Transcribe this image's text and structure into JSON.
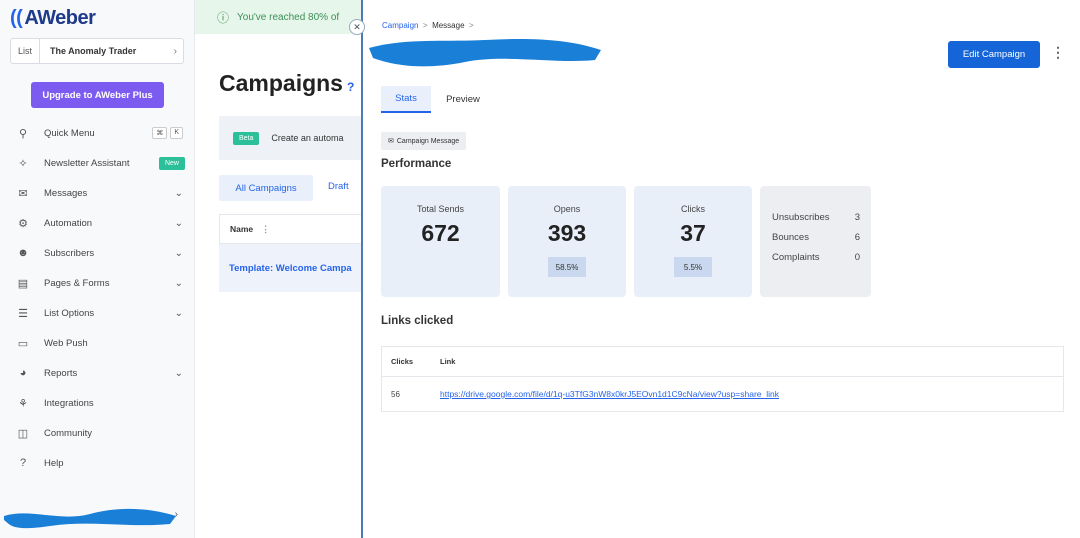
{
  "sidebar": {
    "logo": "AWeber",
    "list_label": "List",
    "list_value": "The Anomaly Trader",
    "upgrade_label": "Upgrade to AWeber Plus",
    "quick_menu_keys": [
      "⌘",
      "K"
    ],
    "new_badge": "New",
    "items": [
      {
        "label": "Quick Menu",
        "icon": "person-run-icon"
      },
      {
        "label": "Newsletter Assistant",
        "icon": "sparkle-icon"
      },
      {
        "label": "Messages",
        "icon": "mail-icon"
      },
      {
        "label": "Automation",
        "icon": "automation-icon"
      },
      {
        "label": "Subscribers",
        "icon": "users-icon"
      },
      {
        "label": "Pages & Forms",
        "icon": "layout-icon"
      },
      {
        "label": "List Options",
        "icon": "list-icon"
      },
      {
        "label": "Web Push",
        "icon": "push-icon"
      },
      {
        "label": "Reports",
        "icon": "chart-icon"
      },
      {
        "label": "Integrations",
        "icon": "plug-icon"
      },
      {
        "label": "Community",
        "icon": "community-icon"
      },
      {
        "label": "Help",
        "icon": "help-icon"
      }
    ]
  },
  "main": {
    "alert_text": "You've reached 80% of",
    "title": "Campaigns",
    "beta_badge": "Beta",
    "beta_text": "Create an automa",
    "tab_all": "All Campaigns",
    "tab_draft": "Draft",
    "table_header_name": "Name",
    "row_name": "Template: Welcome Campa"
  },
  "panel": {
    "breadcrumb": [
      "Campaign",
      "Message"
    ],
    "edit_button": "Edit Campaign",
    "tabs": [
      "Stats",
      "Preview"
    ],
    "chip_label": "Campaign Message",
    "performance_heading": "Performance",
    "cards": [
      {
        "label": "Total Sends",
        "value": "672"
      },
      {
        "label": "Opens",
        "value": "393",
        "pct": "58.5%"
      },
      {
        "label": "Clicks",
        "value": "37",
        "pct": "5.5%"
      }
    ],
    "side_stats": [
      {
        "label": "Unsubscribes",
        "value": "3"
      },
      {
        "label": "Bounces",
        "value": "6"
      },
      {
        "label": "Complaints",
        "value": "0"
      }
    ],
    "links_heading": "Links clicked",
    "links_columns": [
      "Clicks",
      "Link"
    ],
    "links_rows": [
      {
        "clicks": "56",
        "link": "https://drive.google.com/file/d/1q-u3TfG3nW8x0krJ5EOvn1d1C9cNa/view?usp=share_link"
      }
    ]
  },
  "colors": {
    "accent": "#2563eb",
    "upgrade": "#7c5cf0",
    "badge": "#2bbf9a",
    "redaction": "#1a7fd6"
  }
}
